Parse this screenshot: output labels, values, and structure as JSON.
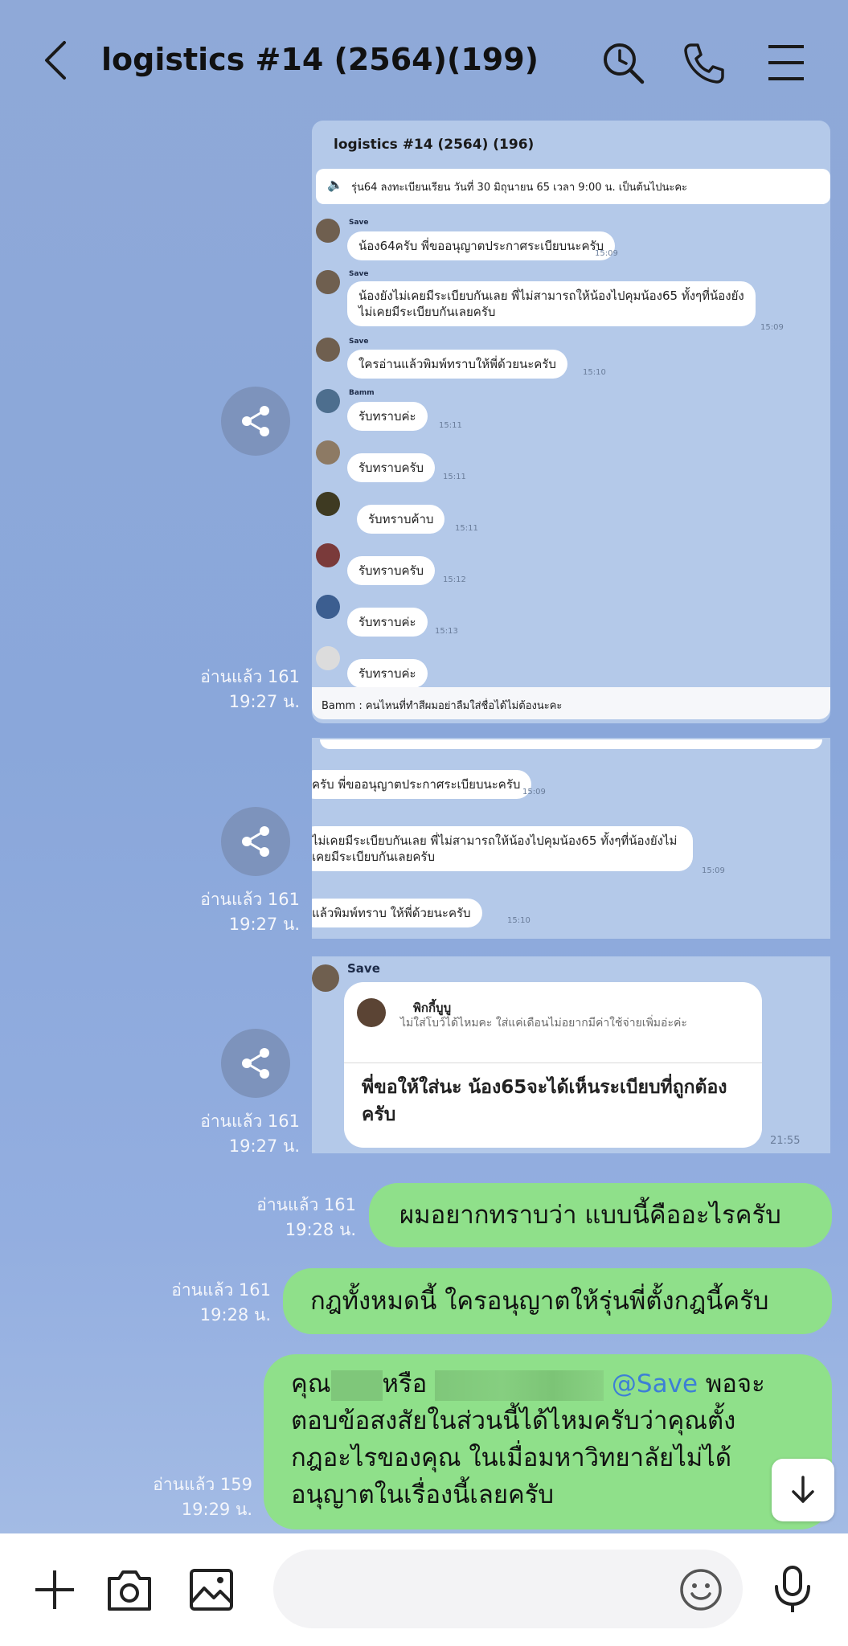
{
  "header": {
    "title": "logistics #14 (2564)(199)"
  },
  "shared_screenshot_1": {
    "title": "logistics #14 (2564) (196)",
    "announcement": "รุ่น64 ลงทะเบียนเรียน วันที่ 30 มิถุนายน 65 เวลา 9:00 น. เป็นต้นไปนะคะ",
    "messages": [
      {
        "name": "Save",
        "text": "น้อง64ครับ พี่ขออนุญาตประกาศระเบียบนะครับ",
        "time": "15:09"
      },
      {
        "name": "Save",
        "text": "น้องยังไม่เคยมีระเบียบกันเลย พี่ไม่สามารถให้น้องไปคุมน้อง65 ทั้งๆที่น้องยังไม่เคยมีระเบียบกันเลยครับ",
        "time": "15:09"
      },
      {
        "name": "Save",
        "text": "ใครอ่านแล้วพิมพ์ทราบให้พี่ด้วยนะครับ",
        "time": "15:10"
      },
      {
        "name": "Bamm",
        "text": "รับทราบค่ะ",
        "time": "15:11"
      },
      {
        "name": "",
        "text": "รับทราบครับ",
        "time": "15:11"
      },
      {
        "name": "",
        "text": "รับทราบค้าบ",
        "time": "15:11"
      },
      {
        "name": "",
        "text": "รับทราบครับ",
        "time": "15:12"
      },
      {
        "name": "",
        "text": "รับทราบค่ะ",
        "time": "15:13"
      },
      {
        "name": "",
        "text": "รับทราบค่ะ",
        "time": ""
      }
    ],
    "footer": "Bamm : คนไหนที่ทำสีผมอย่าลืมใส่ชื่อได้ไม่ต้องนะคะ",
    "read": "อ่านแล้ว 161",
    "time": "19:27 น."
  },
  "shared_screenshot_2": {
    "messages": [
      {
        "text": "ครับ พี่ขออนุญาตประกาศระเบียบนะครับ",
        "time": "15:09"
      },
      {
        "text": "ไม่เคยมีระเบียบกันเลย พี่ไม่สามารถให้น้องไปคุมน้อง65 ทั้งๆที่น้องยังไม่เคยมีระเบียบกันเลยครับ",
        "time": "15:09"
      },
      {
        "text": "แล้วพิมพ์ทราบ ให้พี่ด้วยนะครับ",
        "time": "15:10"
      }
    ],
    "read": "อ่านแล้ว 161",
    "time": "19:27 น."
  },
  "shared_screenshot_3": {
    "sender": "Save",
    "reply_name": "พิกกี้บูบู",
    "reply_text": "ไม่ใส่โบว์ได้ไหมคะ ใส่แค่เดือนไม่อยากมีค่าใช้จ่ายเพิ่มอ่ะค่ะ",
    "message": "พี่ขอให้ใส่นะ น้อง65จะได้เห็นระเบียบที่ถูกต้องครับ",
    "msg_time": "21:55",
    "read": "อ่านแล้ว 161",
    "time": "19:27 น."
  },
  "outgoing": [
    {
      "text": "ผมอยากทราบว่า แบบนี้คืออะไรครับ",
      "read": "อ่านแล้ว 161",
      "time": "19:28 น."
    },
    {
      "text": "กฎทั้งหมดนี้ ใครอนุญาตให้รุ่นพี่ตั้งกฎนี้ครับ",
      "read": "อ่านแล้ว 161",
      "time": "19:28 น."
    },
    {
      "line1_a": "คุณ",
      "line1_b": "หรือ",
      "mention": "@Save",
      "line1_c": "พอจะ",
      "line2": "ตอบข้อสงสัยในส่วนนี้ได้ไหมครับว่าคุณตั้ง",
      "line3": "กฎอะไรของคุณ ในเมื่อมหาวิทยาลัยไม่ได้",
      "line4": "อนุญาตในเรื่องนี้เลยครับ",
      "read": "อ่านแล้ว 159",
      "time": "19:29 น."
    }
  ],
  "colors": {
    "bubble_green": "#8fe08a",
    "mention_blue": "#3d7fd6",
    "background": "#8aa7da"
  },
  "icons": [
    "back-arrow-icon",
    "search-history-icon",
    "phone-icon",
    "menu-icon",
    "share-icon",
    "scroll-down-icon",
    "plus-icon",
    "camera-icon",
    "image-icon",
    "emoji-icon",
    "microphone-icon"
  ]
}
